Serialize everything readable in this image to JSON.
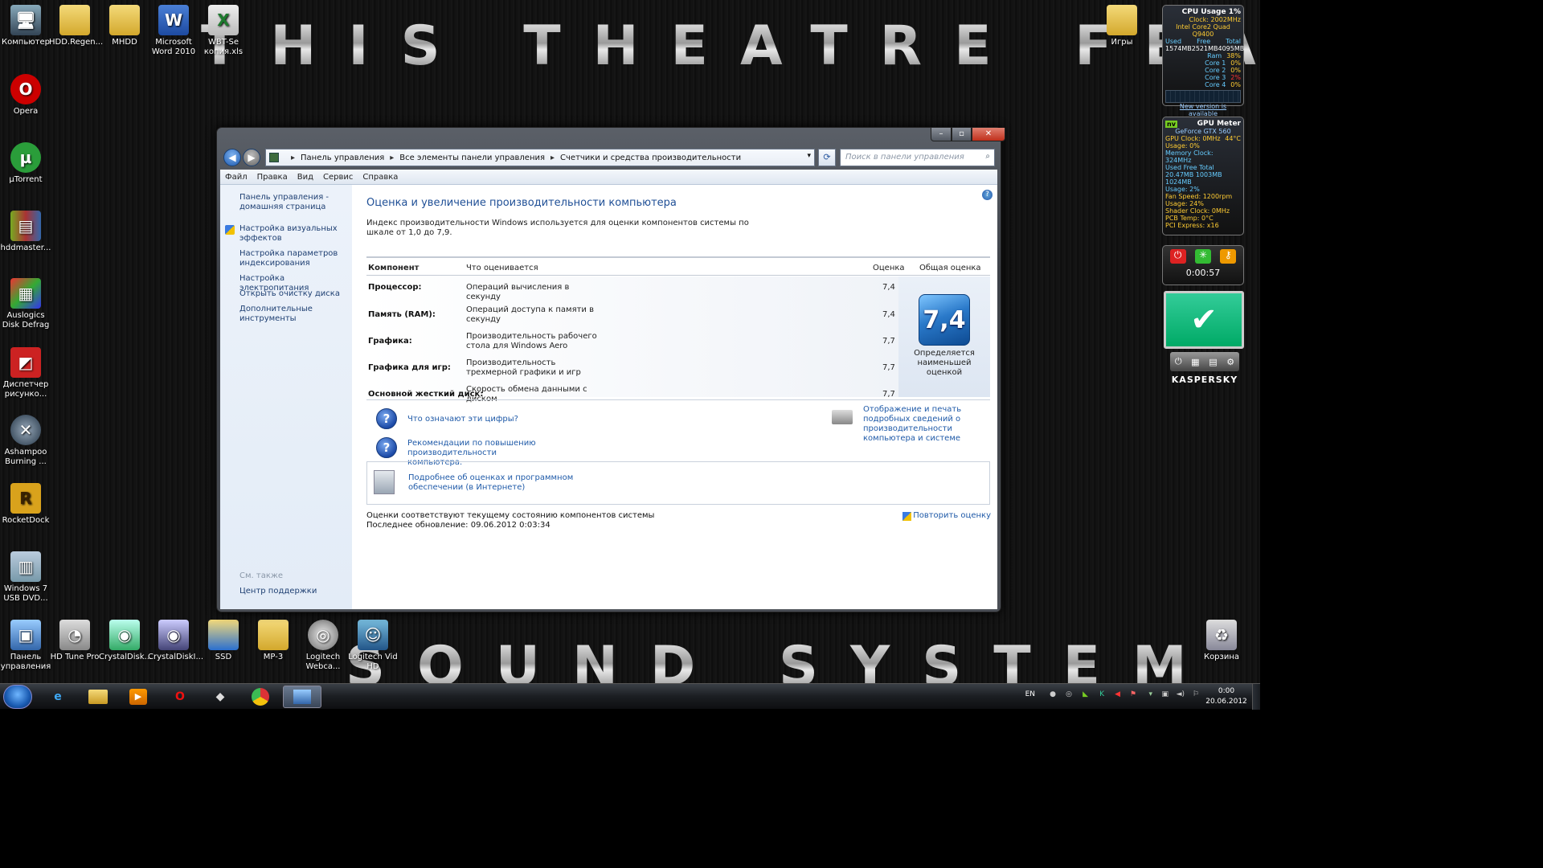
{
  "desktop": {
    "banner_top": "THIS THEATRE FEATURES",
    "banner_bottom": "SOUND SYSTEM",
    "icons_left": [
      {
        "label": "Компьютер",
        "icon": "computer-icon"
      },
      {
        "label": "Opera",
        "icon": "opera-icon"
      },
      {
        "label": "µTorrent",
        "icon": "utorrent-icon"
      },
      {
        "label": "hddmaster...",
        "icon": "winrar-icon"
      },
      {
        "label": "Auslogics Disk Defrag",
        "icon": "defrag-icon"
      },
      {
        "label": "Диспетчер рисунко...",
        "icon": "picture-manager-icon"
      },
      {
        "label": "Ashampoo Burning ...",
        "icon": "ashampoo-icon"
      },
      {
        "label": "RocketDock",
        "icon": "rocketdock-icon"
      },
      {
        "label": "Windows 7 USB DVD...",
        "icon": "usb-dvd-tool-icon"
      }
    ],
    "icons_top": [
      {
        "label": "HDD.Regen...",
        "icon": "folder-icon"
      },
      {
        "label": "MHDD",
        "icon": "folder-icon"
      },
      {
        "label": "Microsoft Word 2010",
        "icon": "word-icon"
      },
      {
        "label": "WBT-Se копия.xls",
        "icon": "excel-icon"
      }
    ],
    "icon_right_top": {
      "label": "Игры",
      "icon": "folder-icon"
    },
    "icons_bottom": [
      {
        "label": "Панель управления",
        "icon": "control-panel-icon"
      },
      {
        "label": "HD Tune Pro",
        "icon": "hdtune-icon"
      },
      {
        "label": "CrystalDisk...",
        "icon": "crystaldisk-icon"
      },
      {
        "label": "CrystalDiskI...",
        "icon": "crystaldiskinfo-icon"
      },
      {
        "label": "SSD",
        "icon": "folder-icon"
      },
      {
        "label": "MP-3",
        "icon": "folder-icon"
      },
      {
        "label": "Logitech Webca...",
        "icon": "webcam-icon"
      },
      {
        "label": "Logitech Vid HD",
        "icon": "logitech-vid-icon"
      }
    ],
    "recycle_bin": "Корзина"
  },
  "gadgets": {
    "cpu": {
      "title": "CPU Usage",
      "percent": "1%",
      "clock": "Clock: 2002MHz",
      "model": "Intel Core2 Quad Q9400",
      "mem_headers": [
        "Used",
        "Free",
        "Total"
      ],
      "mem_values": [
        "1574MB",
        "2521MB",
        "4095MB"
      ],
      "rows": [
        {
          "name": "Ram",
          "value": "38%"
        },
        {
          "name": "Core 1",
          "value": "0%"
        },
        {
          "name": "Core 2",
          "value": "0%"
        },
        {
          "name": "Core 3",
          "value": "2%"
        },
        {
          "name": "Core 4",
          "value": "0%"
        }
      ],
      "footer": "New version is available"
    },
    "gpu": {
      "title": "GPU Meter",
      "model": "GeForce GTX 560",
      "lines": [
        "GPU Clock: 0MHz",
        "Usage: 0%",
        "Memory Clock: 324MHz",
        "Used  Free  Total",
        "20.47MB 1003MB 1024MB",
        "Usage: 2%",
        "Fan Speed: 1200rpm",
        "Usage: 24%",
        "Shader Clock: 0MHz",
        "PCB Temp: 0°C",
        "PCI Express: x16"
      ],
      "temp": "44°C"
    },
    "timer": {
      "time": "0:00:57"
    },
    "kaspersky": {
      "brand": "KASPERSKY"
    }
  },
  "window": {
    "controls": {
      "minimize": "–",
      "maximize": "▫",
      "close": "✕"
    },
    "breadcrumb": [
      "Панель управления",
      "Все элементы панели управления",
      "Счетчики и средства производительности"
    ],
    "search_placeholder": "Поиск в панели управления",
    "menu": [
      "Файл",
      "Правка",
      "Вид",
      "Сервис",
      "Справка"
    ],
    "left_links": [
      "Панель управления - домашняя страница",
      "Настройка визуальных эффектов",
      "Настройка параметров индексирования",
      "Настройка электропитания",
      "Открыть очистку диска",
      "Дополнительные инструменты"
    ],
    "see_also_label": "См. также",
    "see_also_link": "Центр поддержки",
    "title": "Оценка и увеличение производительности компьютера",
    "intro": "Индекс производительности Windows используется для оценки компонентов системы по шкале от 1,0 до 7,9.",
    "table": {
      "headers": [
        "Компонент",
        "Что оценивается",
        "Оценка",
        "Общая оценка"
      ],
      "rows": [
        {
          "component": "Процессор:",
          "what": "Операций вычисления в секунду",
          "score": "7,4"
        },
        {
          "component": "Память (RAM):",
          "what": "Операций доступа к памяти в секунду",
          "score": "7,4"
        },
        {
          "component": "Графика:",
          "what": "Производительность рабочего стола для Windows Aero",
          "score": "7,7"
        },
        {
          "component": "Графика для игр:",
          "what": "Производительность трехмерной графики и игр",
          "score": "7,7"
        },
        {
          "component": "Основной жесткий диск:",
          "what": "Скорость обмена данными с диском",
          "score": "7,7"
        }
      ],
      "base_score": "7,4",
      "base_caption": "Определяется наименьшей оценкой"
    },
    "help_links": [
      "Что означают эти цифры?",
      "Рекомендации по повышению производительности компьютера."
    ],
    "print_link": "Отображение и печать подробных сведений о производительности компьютера и системе",
    "online_link": "Подробнее об оценках и программном обеспечении (в Интернете)",
    "footer_status": "Оценки соответствуют текущему состоянию компонентов системы",
    "footer_updated": "Последнее обновление: 09.06.2012 0:03:34",
    "rerun": "Повторить оценку"
  },
  "taskbar": {
    "items": [
      "internet-explorer-icon",
      "explorer-icon",
      "media-player-icon",
      "opera-icon",
      "fox-icon",
      "chrome-icon",
      "control-panel-icon"
    ],
    "lang": "EN",
    "time": "0:00",
    "date": "20.06.2012"
  }
}
